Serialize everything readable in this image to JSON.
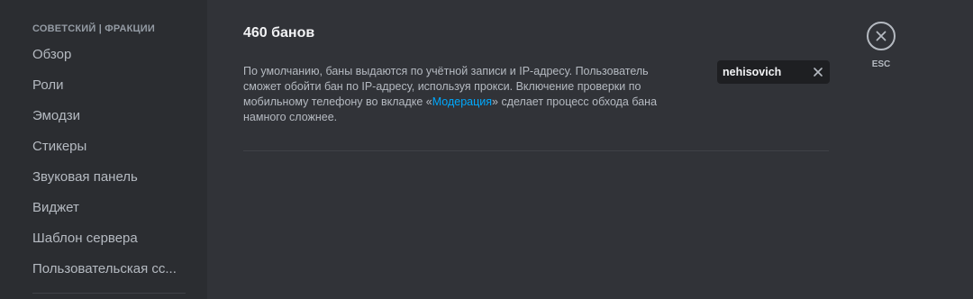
{
  "sidebar": {
    "section_header": "СОВЕТСКИЙ | ФРАКЦИИ",
    "items": [
      {
        "label": "Обзор"
      },
      {
        "label": "Роли"
      },
      {
        "label": "Эмодзи"
      },
      {
        "label": "Стикеры"
      },
      {
        "label": "Звуковая панель"
      },
      {
        "label": "Виджет"
      },
      {
        "label": "Шаблон сервера"
      },
      {
        "label": "Пользовательская сс..."
      }
    ]
  },
  "main": {
    "title": "460 банов",
    "description_before": "По умолчанию, баны выдаются по учётной записи и IP-адресу. Пользователь сможет обойти бан по IP-адресу, используя прокси. Включение проверки по мобильному телефону во вкладке «",
    "description_link": "Модерация",
    "description_after": "» сделает процесс обхода бана намного сложнее.",
    "search": {
      "value": "nehisovich",
      "placeholder": "",
      "clear_icon": "close-icon"
    }
  },
  "close": {
    "icon": "close-circle-icon",
    "label": "ESC"
  },
  "colors": {
    "background": "#313338",
    "sidebar": "#2b2d31",
    "link": "#00a8fc",
    "text_muted": "#b5bac1",
    "heading": "#f2f3f5"
  }
}
